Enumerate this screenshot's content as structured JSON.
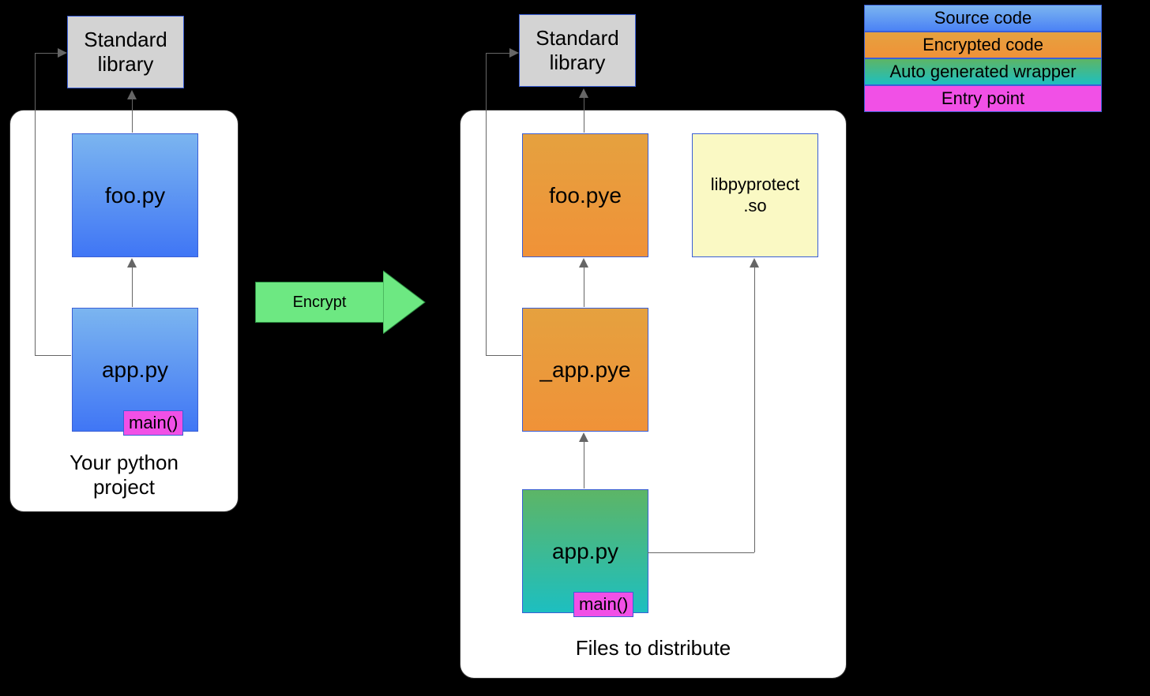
{
  "legend": {
    "source": "Source code",
    "encrypted": "Encrypted code",
    "wrapper": "Auto generated wrapper",
    "entry": "Entry point"
  },
  "left": {
    "stdlib": "Standard\nlibrary",
    "foo": "foo.py",
    "app": "app.py",
    "main": "main()",
    "caption": "Your python\nproject"
  },
  "center": {
    "arrow": "Encrypt"
  },
  "right": {
    "stdlib": "Standard\nlibrary",
    "foo": "foo.pye",
    "app_enc": "_app.pye",
    "app": "app.py",
    "main": "main()",
    "lib": "libpyprotect\n.so",
    "caption": "Files to distribute"
  },
  "colors": {
    "source": "#4b82f5",
    "encrypted": "#f09238",
    "wrapper": "#1dbfc0",
    "entry": "#f150e6",
    "stdlib": "#d3d3d3",
    "lib": "#faf9c4",
    "arrow": "#6de882"
  }
}
